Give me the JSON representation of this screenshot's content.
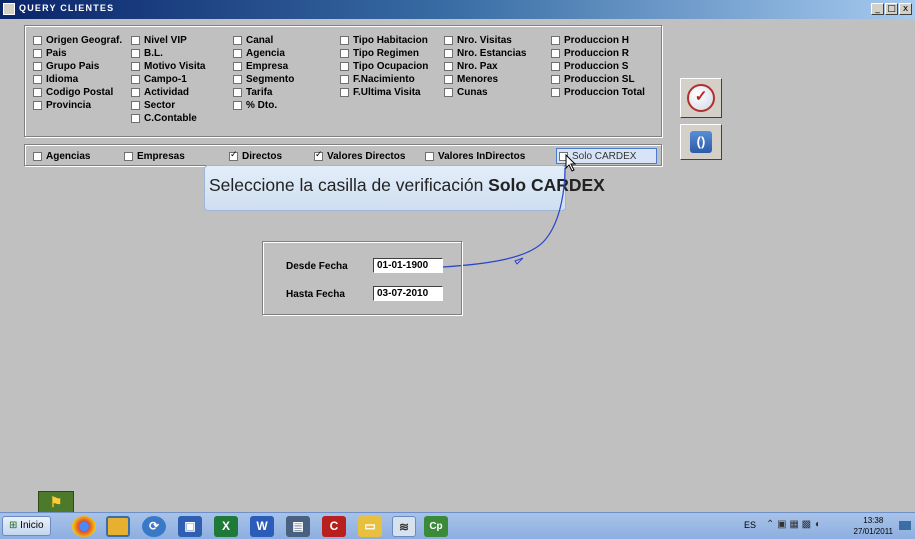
{
  "window": {
    "title": "QUERY CLIENTES",
    "buttons": [
      "_",
      "□",
      "x"
    ]
  },
  "fields": [
    [
      "Origen Geograf.",
      "Pais",
      "Grupo Pais",
      "Idioma",
      "Codigo Postal",
      "Provincia"
    ],
    [
      "Nivel VIP",
      "B.L.",
      "Motivo Visita",
      "Campo-1",
      "Actividad",
      "Sector",
      "C.Contable"
    ],
    [
      "Canal",
      "Agencia",
      "Empresa",
      "Segmento",
      "Tarifa",
      "% Dto."
    ],
    [
      "Tipo Habitacion",
      "Tipo Regimen",
      "Tipo Ocupacion",
      "F.Nacimiento",
      "F.Ultima Visita"
    ],
    [
      "Nro. Visitas",
      "Nro. Estancias",
      "Nro. Pax",
      "Menores",
      "Cunas"
    ],
    [
      "Produccion H",
      "Produccion R",
      "Produccion S",
      "Produccion SL",
      "Produccion Total"
    ]
  ],
  "filters": [
    {
      "label": "Agencias",
      "checked": false
    },
    {
      "label": "Empresas",
      "checked": false
    },
    {
      "label": "Directos",
      "checked": true
    },
    {
      "label": "Valores Directos",
      "checked": true
    },
    {
      "label": "Valores InDirectos",
      "checked": false
    },
    {
      "label": "Solo CARDEX",
      "checked": false,
      "highlighted": true
    }
  ],
  "callout": {
    "text": "Seleccione la casilla de verificación ",
    "bold": "Solo CARDEX"
  },
  "dates": {
    "desde_label": "Desde Fecha",
    "desde_value": "01-01-1900",
    "hasta_label": "Hasta Fecha",
    "hasta_value": "03-07-2010"
  },
  "toolbar_icons": [
    "check-icon",
    "refresh-icon"
  ],
  "taskbar": {
    "start_label": "Inicio",
    "apps": [
      "chrome-icon",
      "app-icon",
      "sync-icon",
      "save-icon",
      "excel-icon",
      "word-icon",
      "network-icon",
      "c-icon",
      "folder-icon",
      "sql-icon",
      "cp-icon"
    ],
    "lang": "ES",
    "time": "13:38",
    "date": "27/01/2011"
  }
}
